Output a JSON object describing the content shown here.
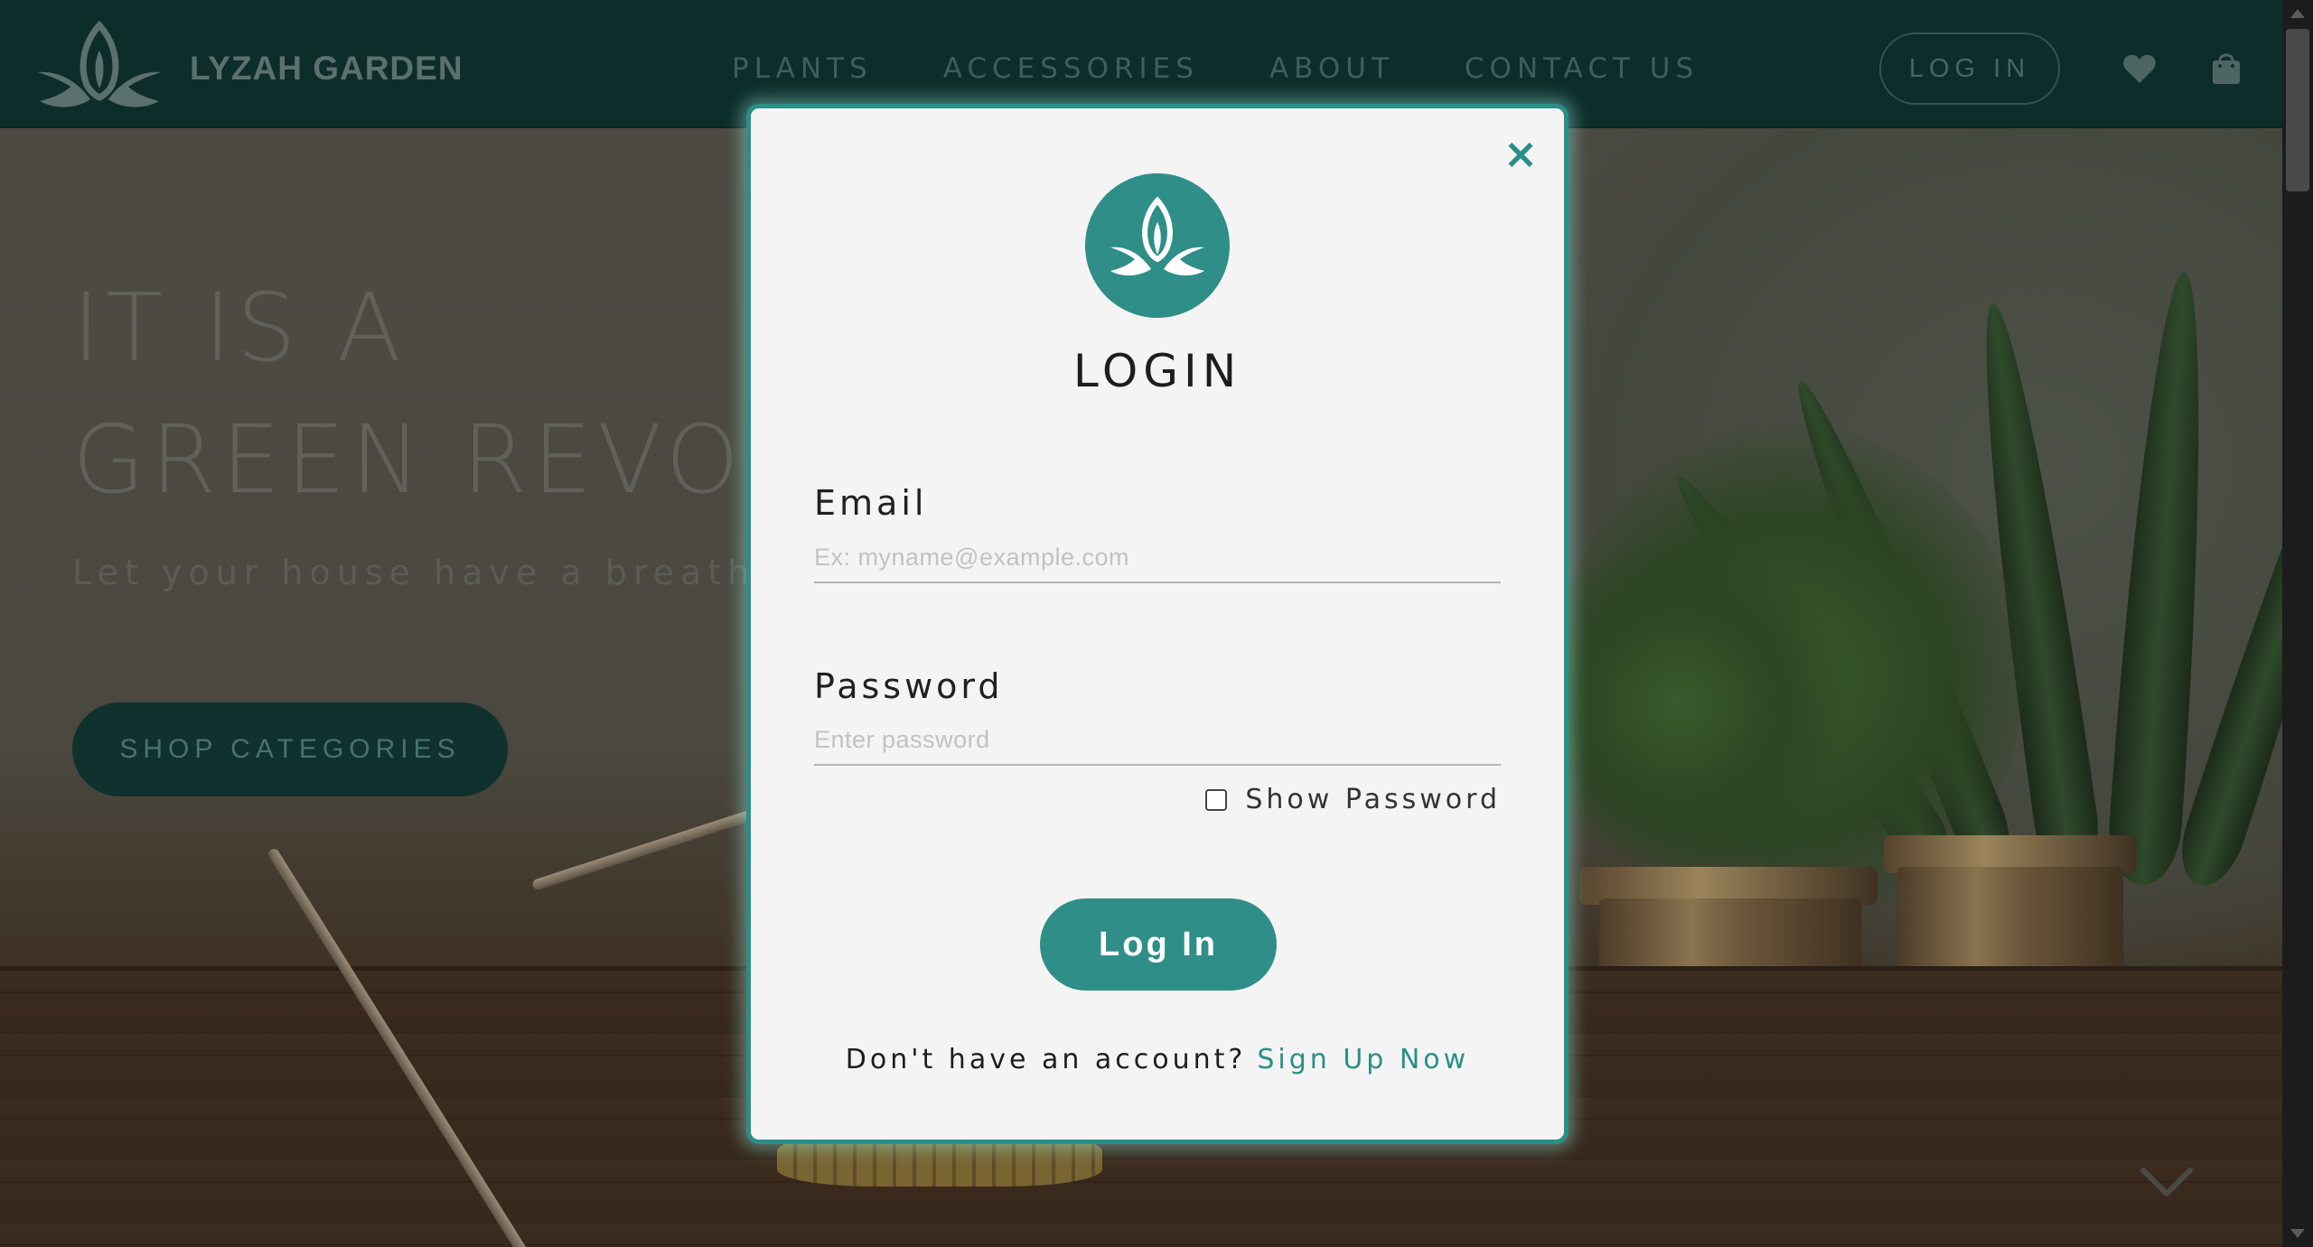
{
  "header": {
    "brand": "LYZAH GARDEN",
    "nav": [
      "PLANTS",
      "ACCESSORIES",
      "ABOUT",
      "CONTACT US"
    ],
    "login_label": "LOG IN",
    "icons": [
      "heart-icon",
      "shopping-bag-icon"
    ]
  },
  "hero": {
    "title_line1": "IT IS A",
    "title_line2": "GREEN REVOL",
    "subtitle": "Let your house have a breath of fre",
    "cta_label": "SHOP CATEGORIES"
  },
  "modal": {
    "title": "LOGIN",
    "email_label": "Email",
    "email_placeholder": "Ex: myname@example.com",
    "password_label": "Password",
    "password_placeholder": "Enter password",
    "show_password_label": "Show Password",
    "show_password_checked": false,
    "submit_label": "Log In",
    "signup_prompt": "Don't have an account?",
    "signup_link": "Sign Up Now"
  },
  "colors": {
    "accent": "#2f8f88",
    "header_bg": "#0d2d2b",
    "modal_bg": "#f4f4f4"
  }
}
